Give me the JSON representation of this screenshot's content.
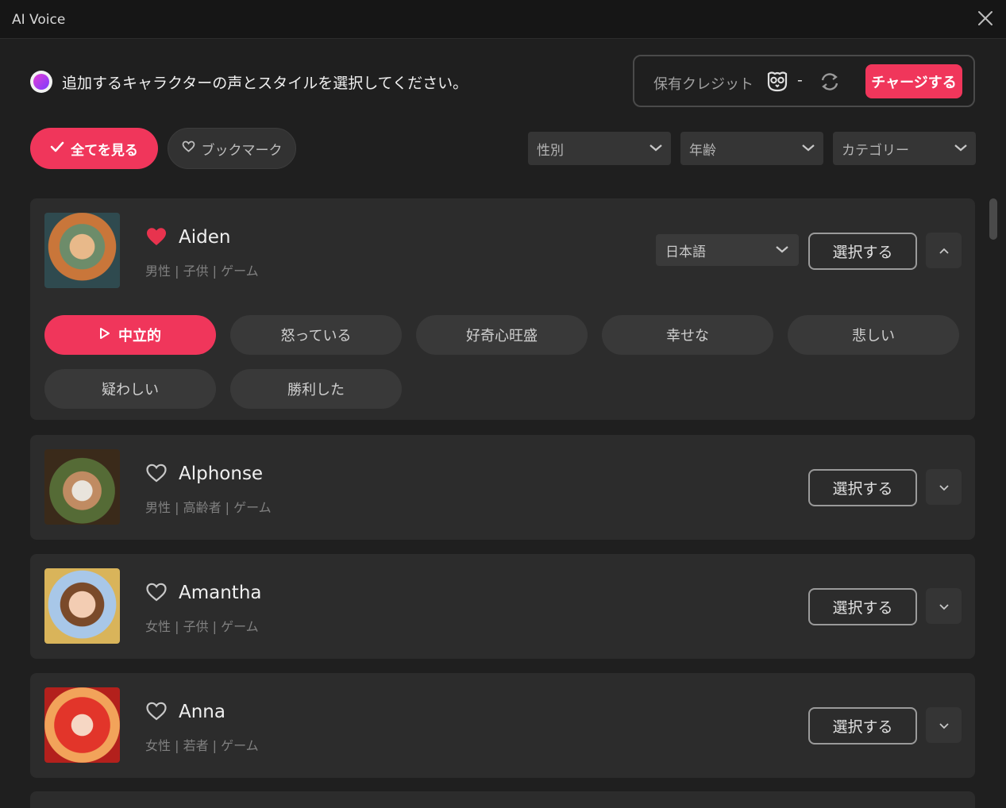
{
  "window": {
    "title": "AI Voice"
  },
  "header": {
    "message": "追加するキャラクターの声とスタイルを選択してください。"
  },
  "credits": {
    "label": "保有クレジット",
    "value": "-",
    "charge_label": "チャージする"
  },
  "tabs": {
    "all_label": "全てを見る",
    "bookmark_label": "ブックマーク"
  },
  "filters": {
    "gender": "性別",
    "age": "年齢",
    "category": "カテゴリー"
  },
  "colors": {
    "accent": "#f0365b",
    "background": "#1f1f1f",
    "card": "#2c2c2c"
  },
  "voices": [
    {
      "name": "Aiden",
      "meta": "男性 | 子供 | ゲーム",
      "favorited": true,
      "expanded": true,
      "language": "日本語",
      "select_label": "選択する",
      "styles": [
        "中立的",
        "怒っている",
        "好奇心旺盛",
        "幸せな",
        "悲しい",
        "疑わしい",
        "勝利した"
      ],
      "active_style": "中立的"
    },
    {
      "name": "Alphonse",
      "meta": "男性 | 高齢者 | ゲーム",
      "favorited": false,
      "expanded": false,
      "select_label": "選択する"
    },
    {
      "name": "Amantha",
      "meta": "女性 | 子供 | ゲーム",
      "favorited": false,
      "expanded": false,
      "select_label": "選択する"
    },
    {
      "name": "Anna",
      "meta": "女性 | 若者 | ゲーム",
      "favorited": false,
      "expanded": false,
      "select_label": "選択する"
    }
  ]
}
